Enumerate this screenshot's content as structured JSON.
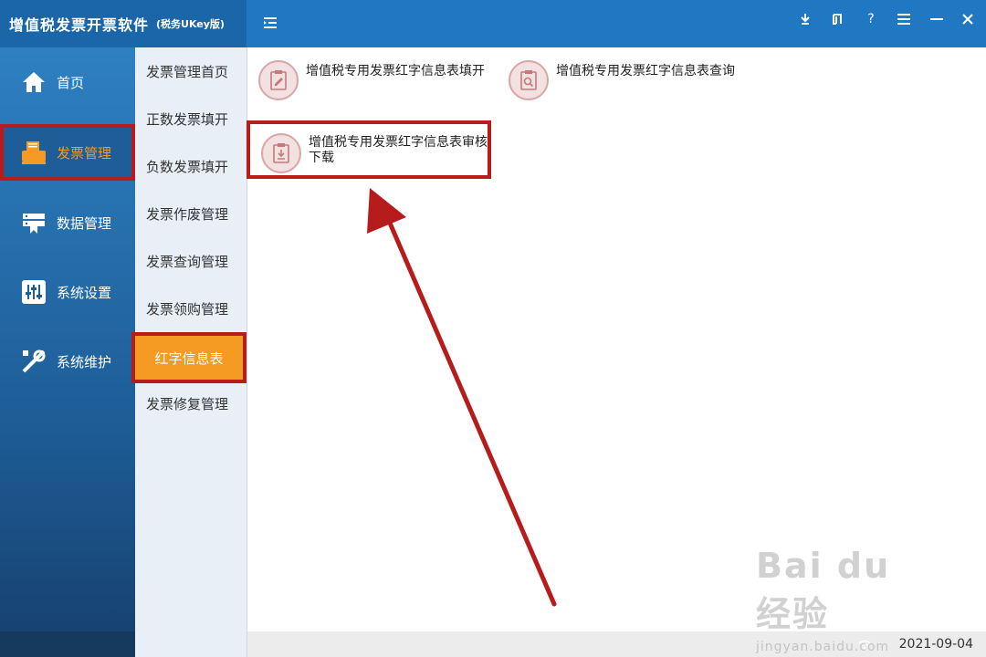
{
  "app": {
    "title": "增值税发票开票软件",
    "subtitle": "(税务UKey版)"
  },
  "sidebar": {
    "items": [
      {
        "label": "首页",
        "icon": "home-icon"
      },
      {
        "label": "发票管理",
        "icon": "printer-icon",
        "active": true
      },
      {
        "label": "数据管理",
        "icon": "database-icon"
      },
      {
        "label": "系统设置",
        "icon": "sliders-icon"
      },
      {
        "label": "系统维护",
        "icon": "tools-icon"
      }
    ]
  },
  "subnav": {
    "items": [
      {
        "label": "发票管理首页"
      },
      {
        "label": "正数发票填开"
      },
      {
        "label": "负数发票填开"
      },
      {
        "label": "发票作废管理"
      },
      {
        "label": "发票查询管理"
      },
      {
        "label": "发票领购管理"
      },
      {
        "label": "红字信息表",
        "active": true
      },
      {
        "label": "发票修复管理"
      }
    ]
  },
  "cards": [
    {
      "label": "增值税专用发票红字信息表填开",
      "icon": "clipboard-edit-icon"
    },
    {
      "label": "增值税专用发票红字信息表查询",
      "icon": "clipboard-search-icon"
    },
    {
      "label": "增值税专用发票红字信息表审核下载",
      "icon": "clipboard-download-icon",
      "highlighted": true
    }
  ],
  "status": {
    "date": "2021-09-04"
  },
  "watermark": {
    "logo": "Bai du 经验",
    "url": "jingyan.baidu.com"
  },
  "colors": {
    "titlebar": "#1f78c1",
    "accent": "#f59a23",
    "highlight_border": "#b71c1c"
  }
}
